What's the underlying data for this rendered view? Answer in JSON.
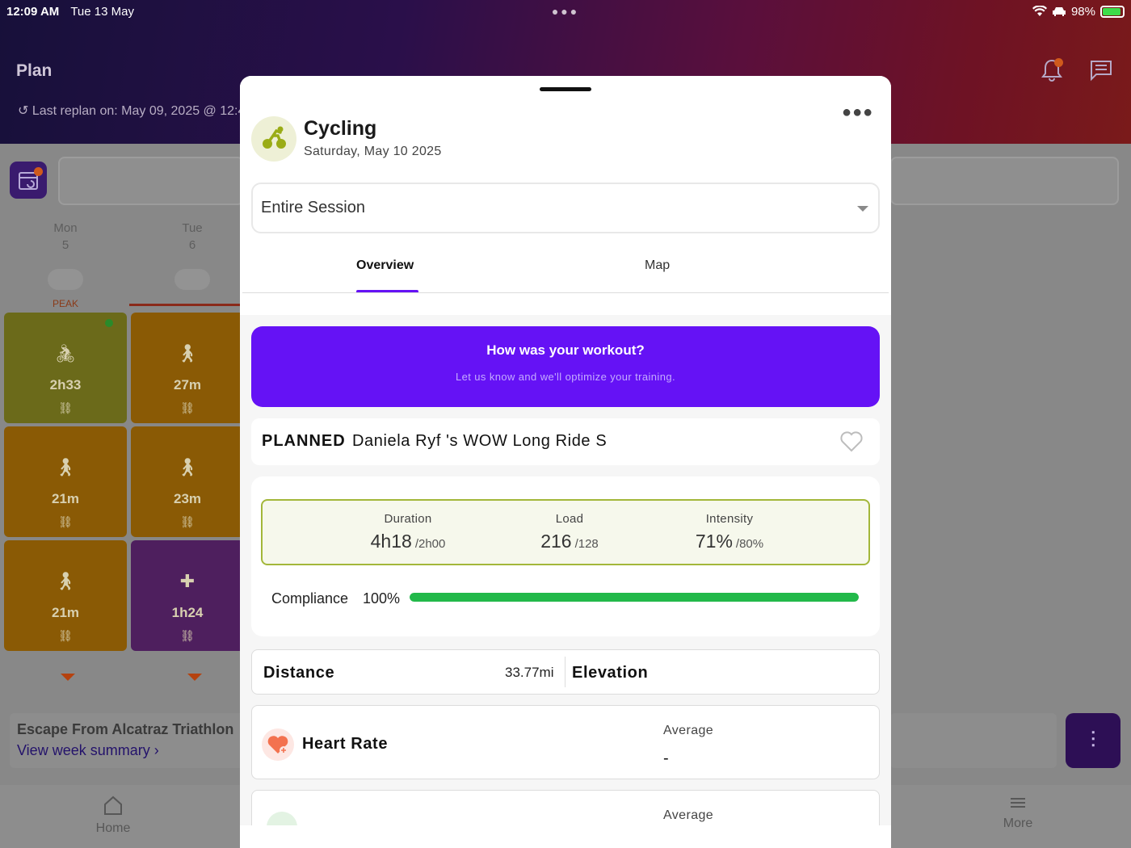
{
  "status_bar": {
    "time": "12:09 AM",
    "date": "Tue 13 May",
    "battery": "98%"
  },
  "background": {
    "page_title": "Plan",
    "last_replan": "Last replan on: May 09, 2025 @ 12:4",
    "days": [
      {
        "name": "Mon",
        "num": "5"
      },
      {
        "name": "Tue",
        "num": "6"
      }
    ],
    "peak_label": "PEAK",
    "tiles": [
      {
        "duration": "2h33",
        "icon": "bike-icon"
      },
      {
        "duration": "27m",
        "icon": "walk-icon"
      },
      {
        "duration": "21m",
        "icon": "walk-icon"
      },
      {
        "duration": "23m",
        "icon": "walk-icon"
      },
      {
        "duration": "21m",
        "icon": "walk-icon"
      },
      {
        "duration": "1h24",
        "icon": "dumbbell-icon"
      }
    ],
    "race_title": "Escape From Alcatraz Triathlon",
    "week_summary_link": "View week summary",
    "tab_home": "Home",
    "tab_more": "More"
  },
  "modal": {
    "activity_title": "Cycling",
    "activity_date": "Saturday, May 10 2025",
    "session_select": "Entire Session",
    "tabs": [
      {
        "label": "Overview",
        "active": true
      },
      {
        "label": "Map",
        "active": false
      }
    ],
    "feedback": {
      "title": "How was your workout?",
      "subtitle": "Let us know and we'll optimize your training."
    },
    "planned_badge": "PLANNED",
    "planned_name": "Daniela Ryf 's WOW Long Ride S",
    "metrics": {
      "duration": {
        "label": "Duration",
        "value": "4h18",
        "target": "/2h00"
      },
      "load": {
        "label": "Load",
        "value": "216",
        "target": "/128"
      },
      "intensity": {
        "label": "Intensity",
        "value": "71%",
        "target": "/80%"
      }
    },
    "compliance": {
      "label": "Compliance",
      "value": "100%",
      "fraction": 1.0
    },
    "distance_label": "Distance",
    "distance_value": "33.77mi",
    "elevation_label": "Elevation",
    "heart_rate": {
      "label": "Heart Rate",
      "avg_label": "Average",
      "avg_value": "-"
    },
    "next_card": {
      "avg_label": "Average"
    }
  },
  "colors": {
    "accent": "#6512f5",
    "compliance_bar": "#22b94a",
    "metrics_border": "#a3b73a"
  }
}
